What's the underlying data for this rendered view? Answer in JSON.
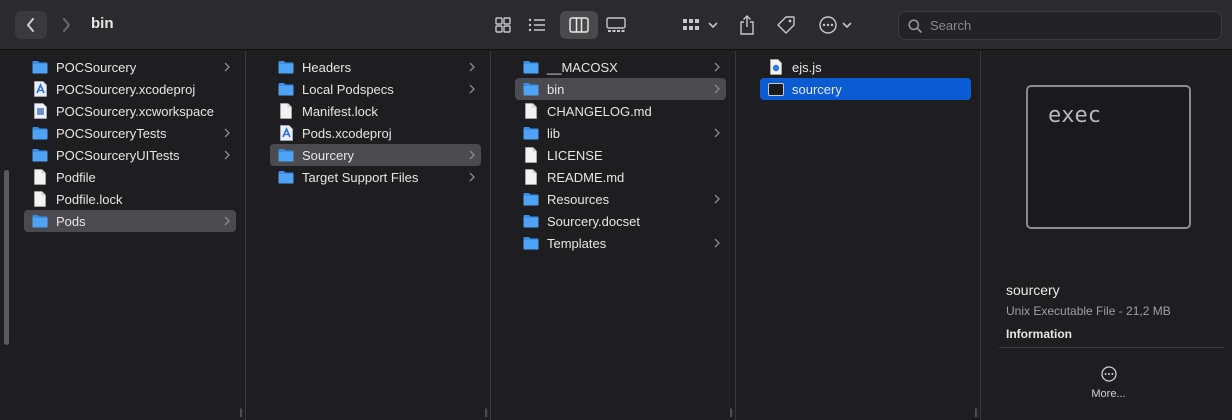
{
  "window": {
    "title": "bin"
  },
  "toolbar": {
    "search_placeholder": "Search",
    "icons": [
      "chevron-left-icon",
      "chevron-right-icon",
      "icon-view-icon",
      "list-view-icon",
      "column-view-icon",
      "gallery-view-icon",
      "group-icon",
      "share-icon",
      "tag-icon",
      "more-actions-icon",
      "search-icon"
    ]
  },
  "columns": [
    {
      "items": [
        {
          "label": "POCSourcery",
          "icon": "folder",
          "chevron": true
        },
        {
          "label": "POCSourcery.xcodeproj",
          "icon": "xcodeproj",
          "chevron": false
        },
        {
          "label": "POCSourcery.xcworkspace",
          "icon": "xcworkspace",
          "chevron": false
        },
        {
          "label": "POCSourceryTests",
          "icon": "folder",
          "chevron": true
        },
        {
          "label": "POCSourceryUITests",
          "icon": "folder",
          "chevron": true
        },
        {
          "label": "Podfile",
          "icon": "file",
          "chevron": false
        },
        {
          "label": "Podfile.lock",
          "icon": "file",
          "chevron": false
        },
        {
          "label": "Pods",
          "icon": "folder",
          "chevron": true,
          "selected": true
        }
      ]
    },
    {
      "items": [
        {
          "label": "Headers",
          "icon": "folder",
          "chevron": true
        },
        {
          "label": "Local Podspecs",
          "icon": "folder",
          "chevron": true
        },
        {
          "label": "Manifest.lock",
          "icon": "file",
          "chevron": false
        },
        {
          "label": "Pods.xcodeproj",
          "icon": "xcodeproj",
          "chevron": false
        },
        {
          "label": "Sourcery",
          "icon": "folder",
          "chevron": true,
          "selected": true
        },
        {
          "label": "Target Support Files",
          "icon": "folder",
          "chevron": true
        }
      ]
    },
    {
      "items": [
        {
          "label": "__MACOSX",
          "icon": "folder",
          "chevron": true
        },
        {
          "label": "bin",
          "icon": "folder",
          "chevron": true,
          "selected": true
        },
        {
          "label": "CHANGELOG.md",
          "icon": "file",
          "chevron": false
        },
        {
          "label": "lib",
          "icon": "folder",
          "chevron": true
        },
        {
          "label": "LICENSE",
          "icon": "file",
          "chevron": false
        },
        {
          "label": "README.md",
          "icon": "file",
          "chevron": false
        },
        {
          "label": "Resources",
          "icon": "folder",
          "chevron": true
        },
        {
          "label": "Sourcery.docset",
          "icon": "folder",
          "chevron": false
        },
        {
          "label": "Templates",
          "icon": "folder",
          "chevron": true
        }
      ]
    },
    {
      "items": [
        {
          "label": "ejs.js",
          "icon": "jsfile",
          "chevron": false
        },
        {
          "label": "sourcery",
          "icon": "exec",
          "chevron": false,
          "selected": true,
          "active": true
        }
      ]
    }
  ],
  "preview": {
    "thumbnail_text": "exec",
    "name": "sourcery",
    "kind": "Unix Executable File - 21,2 MB",
    "info_heading": "Information",
    "more_label": "More..."
  }
}
